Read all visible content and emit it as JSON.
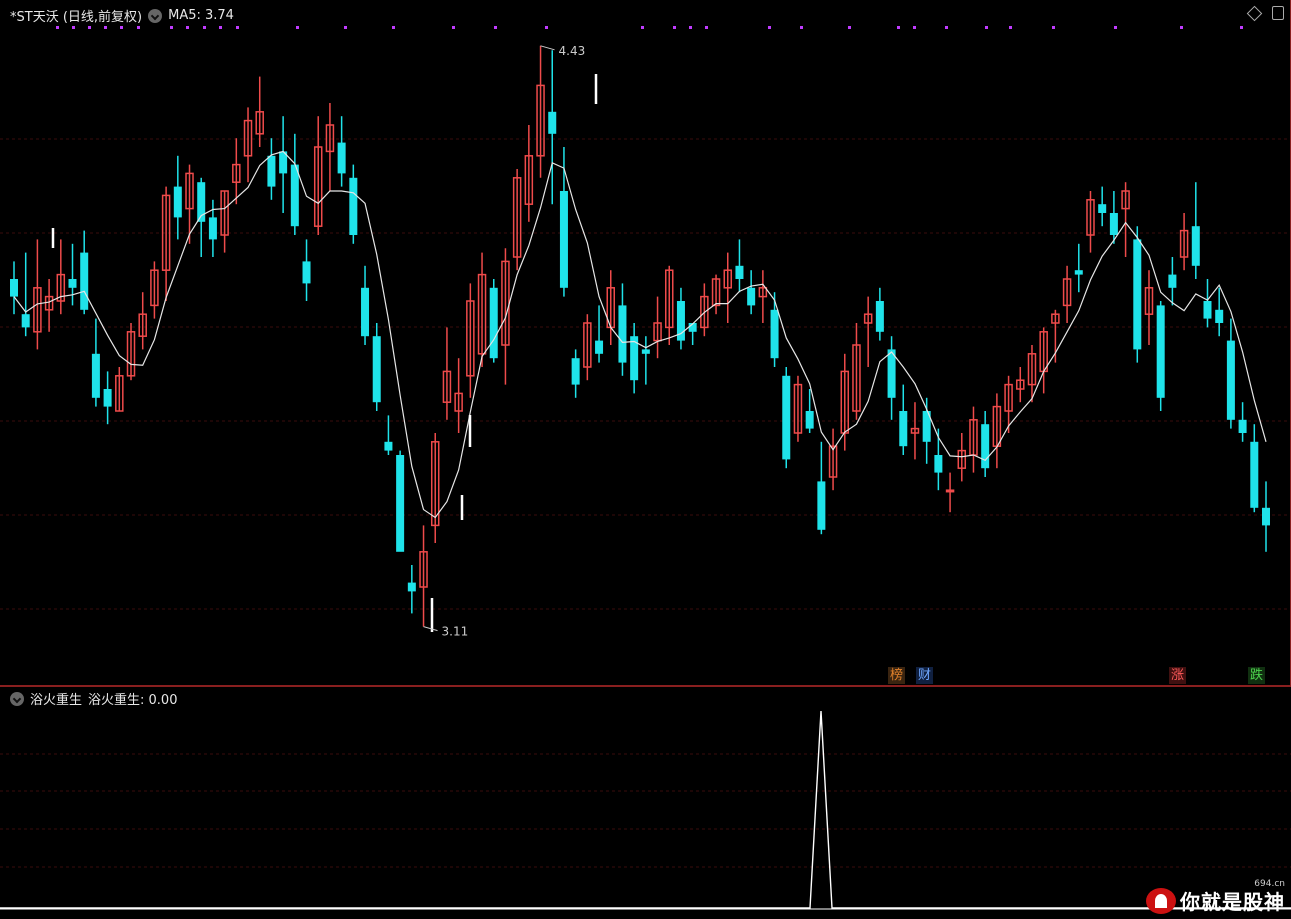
{
  "header": {
    "title": "*ST天沃 (日线,前复权)",
    "indicator": "MA5: 3.74"
  },
  "sub": {
    "name": "浴火重生",
    "indicator": "浴火重生: 0.00"
  },
  "markers": {
    "high": "4.43",
    "low": "3.11"
  },
  "badges": [
    {
      "text": "榜",
      "color": "#e0802a",
      "bg": "#3a2410"
    },
    {
      "text": "财",
      "color": "#6fa8ff",
      "bg": "#102040"
    },
    {
      "text": "涨",
      "color": "#ff5a5a",
      "bg": "#401010"
    },
    {
      "text": "跌",
      "color": "#4cd14c",
      "bg": "#103010"
    }
  ],
  "watermark": {
    "text": "你就是股神",
    "sub": "694.cn"
  },
  "colors": {
    "up": "#ef4b4b",
    "down": "#1fe3ea",
    "ma": "#e6e6e6",
    "grid": "#3a0d0d",
    "dot": "#c03cff"
  },
  "chart_data": {
    "type": "candlestick",
    "series_name": "MA5",
    "ohlc": [
      [
        3.9,
        3.94,
        3.82,
        3.86
      ],
      [
        3.82,
        3.96,
        3.77,
        3.79
      ],
      [
        3.78,
        3.99,
        3.74,
        3.88
      ],
      [
        3.83,
        3.9,
        3.78,
        3.86
      ],
      [
        3.85,
        3.99,
        3.82,
        3.91
      ],
      [
        3.9,
        3.98,
        3.84,
        3.88
      ],
      [
        3.96,
        4.01,
        3.82,
        3.83
      ],
      [
        3.73,
        3.81,
        3.61,
        3.63
      ],
      [
        3.65,
        3.69,
        3.57,
        3.61
      ],
      [
        3.6,
        3.7,
        3.6,
        3.68
      ],
      [
        3.68,
        3.8,
        3.67,
        3.78
      ],
      [
        3.77,
        3.87,
        3.74,
        3.82
      ],
      [
        3.84,
        3.94,
        3.81,
        3.92
      ],
      [
        3.92,
        4.11,
        3.85,
        4.09
      ],
      [
        4.11,
        4.18,
        3.99,
        4.04
      ],
      [
        4.06,
        4.16,
        3.98,
        4.14
      ],
      [
        4.12,
        4.13,
        3.95,
        4.03
      ],
      [
        4.04,
        4.08,
        3.95,
        3.99
      ],
      [
        4.0,
        4.1,
        3.96,
        4.1
      ],
      [
        4.12,
        4.22,
        4.07,
        4.16
      ],
      [
        4.18,
        4.29,
        4.12,
        4.26
      ],
      [
        4.23,
        4.36,
        4.2,
        4.28
      ],
      [
        4.18,
        4.22,
        4.08,
        4.11
      ],
      [
        4.19,
        4.27,
        4.05,
        4.14
      ],
      [
        4.16,
        4.23,
        4.0,
        4.02
      ],
      [
        3.94,
        3.99,
        3.85,
        3.89
      ],
      [
        4.02,
        4.27,
        4.0,
        4.2
      ],
      [
        4.19,
        4.3,
        4.1,
        4.25
      ],
      [
        4.21,
        4.27,
        4.11,
        4.14
      ],
      [
        4.13,
        4.16,
        3.98,
        4.0
      ],
      [
        3.88,
        3.93,
        3.75,
        3.77
      ],
      [
        3.77,
        3.8,
        3.6,
        3.62
      ],
      [
        3.53,
        3.59,
        3.5,
        3.51
      ],
      [
        3.5,
        3.51,
        3.3,
        3.28
      ],
      [
        3.21,
        3.25,
        3.14,
        3.19
      ],
      [
        3.2,
        3.34,
        3.11,
        3.28
      ],
      [
        3.34,
        3.55,
        3.3,
        3.53
      ],
      [
        3.62,
        3.79,
        3.58,
        3.69
      ],
      [
        3.6,
        3.72,
        3.55,
        3.64
      ],
      [
        3.68,
        3.89,
        3.63,
        3.85
      ],
      [
        3.73,
        3.96,
        3.7,
        3.91
      ],
      [
        3.88,
        3.9,
        3.71,
        3.72
      ],
      [
        3.75,
        3.97,
        3.66,
        3.94
      ],
      [
        3.95,
        4.15,
        3.92,
        4.13
      ],
      [
        4.07,
        4.25,
        4.03,
        4.18
      ],
      [
        4.18,
        4.43,
        4.13,
        4.34
      ],
      [
        4.28,
        4.42,
        4.07,
        4.23
      ],
      [
        4.1,
        4.2,
        3.86,
        3.88
      ],
      [
        3.72,
        3.74,
        3.63,
        3.66
      ],
      [
        3.7,
        3.82,
        3.67,
        3.8
      ],
      [
        3.76,
        3.84,
        3.71,
        3.73
      ],
      [
        3.79,
        3.92,
        3.75,
        3.88
      ],
      [
        3.84,
        3.89,
        3.68,
        3.71
      ],
      [
        3.77,
        3.8,
        3.64,
        3.67
      ],
      [
        3.74,
        3.77,
        3.66,
        3.73
      ],
      [
        3.76,
        3.86,
        3.72,
        3.8
      ],
      [
        3.79,
        3.93,
        3.75,
        3.92
      ],
      [
        3.85,
        3.88,
        3.74,
        3.76
      ],
      [
        3.8,
        3.8,
        3.75,
        3.78
      ],
      [
        3.79,
        3.89,
        3.77,
        3.86
      ],
      [
        3.84,
        3.91,
        3.82,
        3.9
      ],
      [
        3.88,
        3.96,
        3.8,
        3.92
      ],
      [
        3.93,
        3.99,
        3.87,
        3.9
      ],
      [
        3.88,
        3.92,
        3.82,
        3.84
      ],
      [
        3.86,
        3.92,
        3.8,
        3.88
      ],
      [
        3.83,
        3.87,
        3.7,
        3.72
      ],
      [
        3.68,
        3.7,
        3.47,
        3.49
      ],
      [
        3.55,
        3.68,
        3.53,
        3.66
      ],
      [
        3.6,
        3.65,
        3.55,
        3.56
      ],
      [
        3.44,
        3.53,
        3.32,
        3.33
      ],
      [
        3.45,
        3.56,
        3.42,
        3.52
      ],
      [
        3.55,
        3.73,
        3.51,
        3.69
      ],
      [
        3.6,
        3.8,
        3.58,
        3.75
      ],
      [
        3.8,
        3.86,
        3.7,
        3.82
      ],
      [
        3.85,
        3.88,
        3.76,
        3.78
      ],
      [
        3.74,
        3.77,
        3.58,
        3.63
      ],
      [
        3.6,
        3.66,
        3.5,
        3.52
      ],
      [
        3.55,
        3.62,
        3.49,
        3.56
      ],
      [
        3.6,
        3.63,
        3.48,
        3.53
      ],
      [
        3.5,
        3.56,
        3.42,
        3.46
      ],
      [
        3.42,
        3.46,
        3.37,
        3.42
      ],
      [
        3.47,
        3.55,
        3.44,
        3.51
      ],
      [
        3.5,
        3.61,
        3.46,
        3.58
      ],
      [
        3.57,
        3.6,
        3.45,
        3.47
      ],
      [
        3.52,
        3.64,
        3.47,
        3.61
      ],
      [
        3.6,
        3.68,
        3.55,
        3.66
      ],
      [
        3.65,
        3.7,
        3.62,
        3.67
      ],
      [
        3.66,
        3.75,
        3.62,
        3.73
      ],
      [
        3.69,
        3.79,
        3.64,
        3.78
      ],
      [
        3.8,
        3.83,
        3.71,
        3.82
      ],
      [
        3.84,
        3.93,
        3.8,
        3.9
      ],
      [
        3.92,
        3.98,
        3.87,
        3.91
      ],
      [
        4.0,
        4.1,
        3.96,
        4.08
      ],
      [
        4.07,
        4.11,
        4.02,
        4.05
      ],
      [
        4.05,
        4.1,
        3.98,
        4.0
      ],
      [
        4.06,
        4.12,
        3.95,
        4.1
      ],
      [
        3.99,
        4.02,
        3.71,
        3.74
      ],
      [
        3.82,
        3.92,
        3.75,
        3.88
      ],
      [
        3.84,
        3.85,
        3.6,
        3.63
      ],
      [
        3.91,
        3.95,
        3.84,
        3.88
      ],
      [
        3.95,
        4.05,
        3.92,
        4.01
      ],
      [
        4.02,
        4.12,
        3.9,
        3.93
      ],
      [
        3.85,
        3.9,
        3.79,
        3.81
      ],
      [
        3.83,
        3.88,
        3.77,
        3.8
      ],
      [
        3.76,
        3.81,
        3.56,
        3.58
      ],
      [
        3.58,
        3.62,
        3.53,
        3.55
      ],
      [
        3.53,
        3.57,
        3.37,
        3.38
      ],
      [
        3.38,
        3.44,
        3.28,
        3.34
      ]
    ]
  }
}
